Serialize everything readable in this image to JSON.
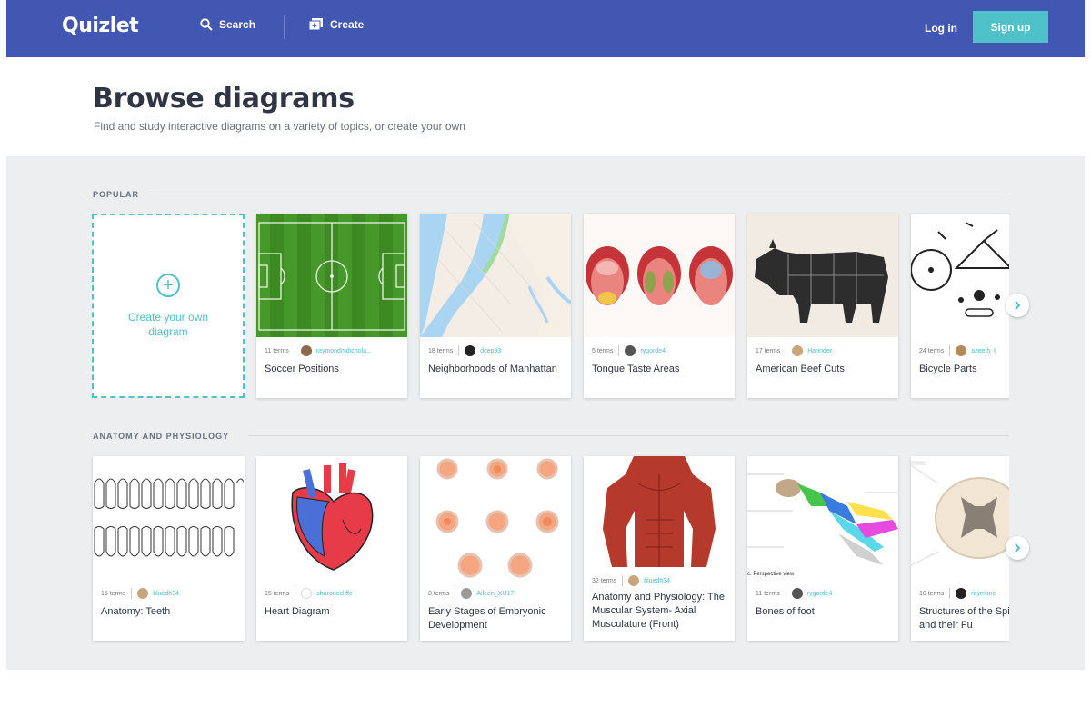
{
  "topbar": {
    "logo": "Quizlet",
    "search_label": "Search",
    "create_label": "Create",
    "login_label": "Log in",
    "signup_label": "Sign up",
    "bg_color": "#4257b2",
    "accent_color": "#4fc1c9"
  },
  "header": {
    "title": "Browse diagrams",
    "subtitle": "Find and study interactive diagrams on a variety of topics, or create your own"
  },
  "create_card": {
    "label": "Create your own diagram"
  },
  "sections": [
    {
      "label": "POPULAR",
      "cards": [
        {
          "terms": "11 terms",
          "user": "raymondmdichola...",
          "title": "Soccer Positions",
          "icon": "soccer-field"
        },
        {
          "terms": "18 terms",
          "user": "dcep93",
          "title": "Neighborhoods of Manhattan",
          "icon": "manhattan-map"
        },
        {
          "terms": "5 terms",
          "user": "rygorde4",
          "title": "Tongue Taste Areas",
          "icon": "tongue"
        },
        {
          "terms": "17 terms",
          "user": "Harinder_",
          "title": "American Beef Cuts",
          "icon": "beef-cuts"
        },
        {
          "terms": "24 terms",
          "user": "azeeth_t",
          "title": "Bicycle Parts",
          "icon": "bicycle"
        }
      ]
    },
    {
      "label": "ANATOMY AND PHYSIOLOGY",
      "cards": [
        {
          "terms": "15 terms",
          "user": "bluedh34",
          "title": "Anatomy: Teeth",
          "icon": "teeth"
        },
        {
          "terms": "15 terms",
          "user": "sharonecliffe",
          "title": "Heart Diagram",
          "icon": "heart"
        },
        {
          "terms": "8 terms",
          "user": "Aileen_XU17",
          "title": "Early Stages of Embryonic Development",
          "icon": "embryo"
        },
        {
          "terms": "32 terms",
          "user": "bluedh34",
          "title": "Anatomy and Physiology: The Muscular System- Axial Musculature (Front)",
          "icon": "muscles"
        },
        {
          "terms": "11 terms",
          "user": "rygorde4",
          "title": "Bones of foot",
          "icon": "foot-bones",
          "caption": "c. Perspective view"
        },
        {
          "terms": "10 terms",
          "user": "raymonc",
          "title": "Structures of the Spinal Cord and their Fu",
          "icon": "spinal-cord"
        }
      ]
    }
  ]
}
